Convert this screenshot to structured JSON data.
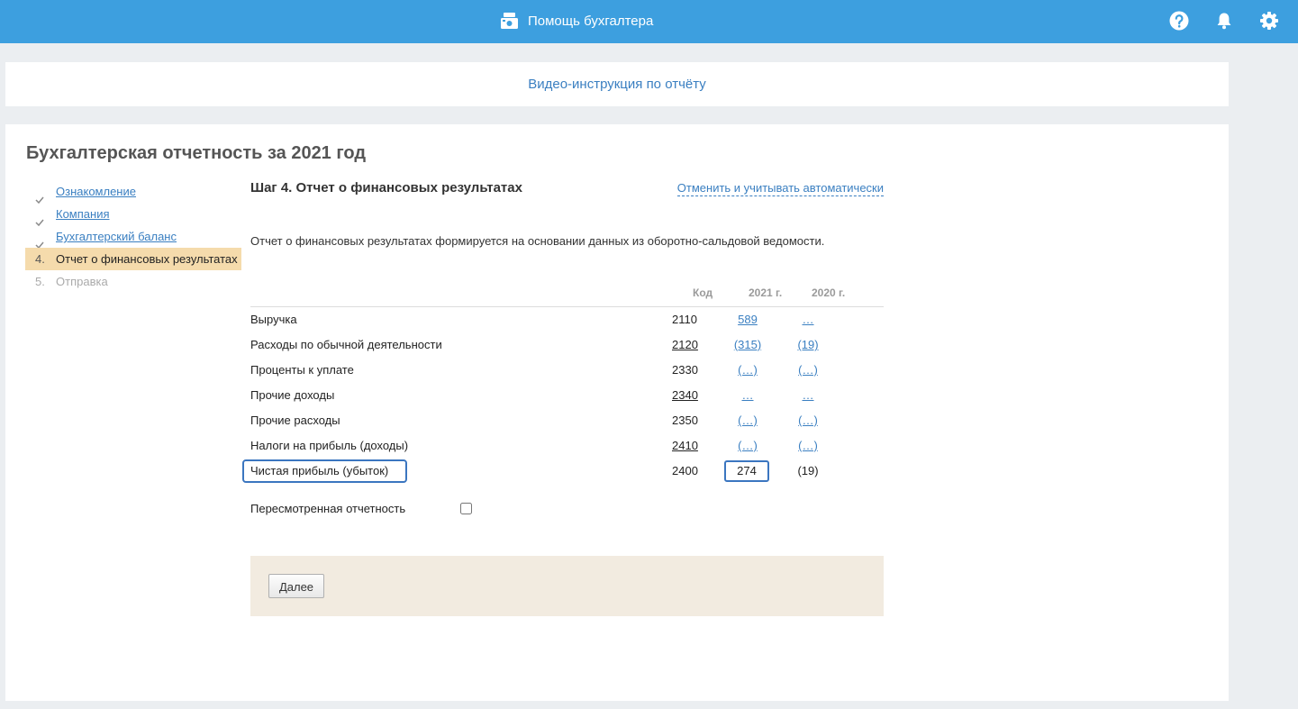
{
  "header": {
    "title": "Помощь бухгалтера",
    "icons": {
      "brand": "cash-register-icon",
      "help": "help-icon",
      "notifications": "bell-icon",
      "settings": "gear-icon"
    }
  },
  "video_link": "Видео-инструкция по отчёту",
  "report": {
    "title": "Бухгалтерская отчетность за 2021 год",
    "steps": [
      {
        "icon": "check-icon",
        "label": "Ознакомление",
        "state": "done"
      },
      {
        "icon": "check-icon",
        "label": "Компания",
        "state": "done"
      },
      {
        "icon": "check-icon",
        "label": "Бухгалтерский баланс",
        "state": "done"
      },
      {
        "marker": "4.",
        "label": "Отчет о финансовых результатах",
        "state": "current"
      },
      {
        "marker": "5.",
        "label": "Отправка",
        "state": "disabled"
      }
    ],
    "step_title": "Шаг 4. Отчет о финансовых результатах",
    "cancel_link": "Отменить и учитывать автоматически",
    "description": "Отчет о финансовых результатах формируется на основании данных из оборотно-сальдовой ведомости.",
    "table": {
      "headers": {
        "code": "Код",
        "y2021": "2021 г.",
        "y2020": "2020 г."
      },
      "rows": [
        {
          "label": "Выручка",
          "code": "2110",
          "v2021": "589",
          "v2020": "…"
        },
        {
          "label": "Расходы по обычной деятельности",
          "code": "2120",
          "v2021": "(315)",
          "v2020": "(19)"
        },
        {
          "label": "Проценты к уплате",
          "code": "2330",
          "v2021": "(…)",
          "v2020": "(…)"
        },
        {
          "label": "Прочие доходы",
          "code": "2340",
          "v2021": "…",
          "v2020": "…"
        },
        {
          "label": "Прочие расходы",
          "code": "2350",
          "v2021": "(…)",
          "v2020": "(…)"
        },
        {
          "label": "Налоги на прибыль (доходы)",
          "code": "2410",
          "v2021": "(…)",
          "v2020": "(…)"
        },
        {
          "label": "Чистая прибыль (убыток)",
          "code": "2400",
          "v2021": "274",
          "v2020": "(19)"
        }
      ]
    },
    "revised_label": "Пересмотренная отчетность",
    "revised_checked": false,
    "next_button": "Далее"
  },
  "colors": {
    "topbar": "#3d9fdf",
    "link": "#3a7fc1",
    "current_step": "#f5dbac",
    "footer_panel": "#f2ebe0",
    "highlight": "#3b76c0"
  }
}
